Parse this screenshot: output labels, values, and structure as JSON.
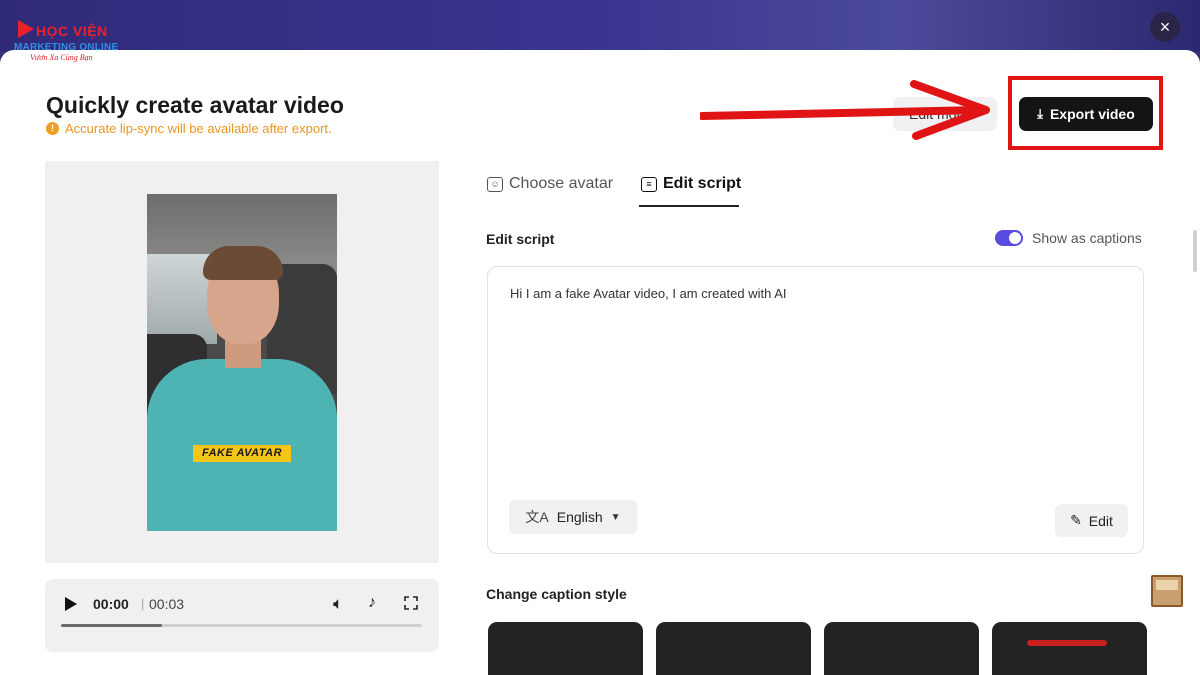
{
  "brand": {
    "line1": "HỌC VIỆN",
    "line2": "MARKETING ONLINE",
    "line3": "Vươn Xa Cùng Bạn"
  },
  "modal": {
    "title": "Quickly create avatar video",
    "notice": "Accurate lip-sync will be available after export.",
    "close_icon": "×",
    "ghost_button_label": "Edit more",
    "export_button_label": "Export video",
    "export_icon": "⤓"
  },
  "preview": {
    "caption_tag": "FAKE AVATAR"
  },
  "player": {
    "current_time": "00:00",
    "separator": "|",
    "total_time": "00:03",
    "progress": 0.28
  },
  "tabs": [
    {
      "label": "Choose avatar",
      "active": false
    },
    {
      "label": "Edit script",
      "active": true
    }
  ],
  "script": {
    "section_label": "Edit script",
    "captions_toggle_label": "Show as captions",
    "captions_enabled": true,
    "text": "Hi I am a fake Avatar video, I am created with AI",
    "language": "English",
    "edit_button_label": "Edit"
  },
  "caption_style": {
    "label": "Change caption style"
  },
  "colors": {
    "accent": "#5a4be2",
    "notice": "#e8961e",
    "annotation": "#e01414",
    "export_bg": "#141414"
  }
}
